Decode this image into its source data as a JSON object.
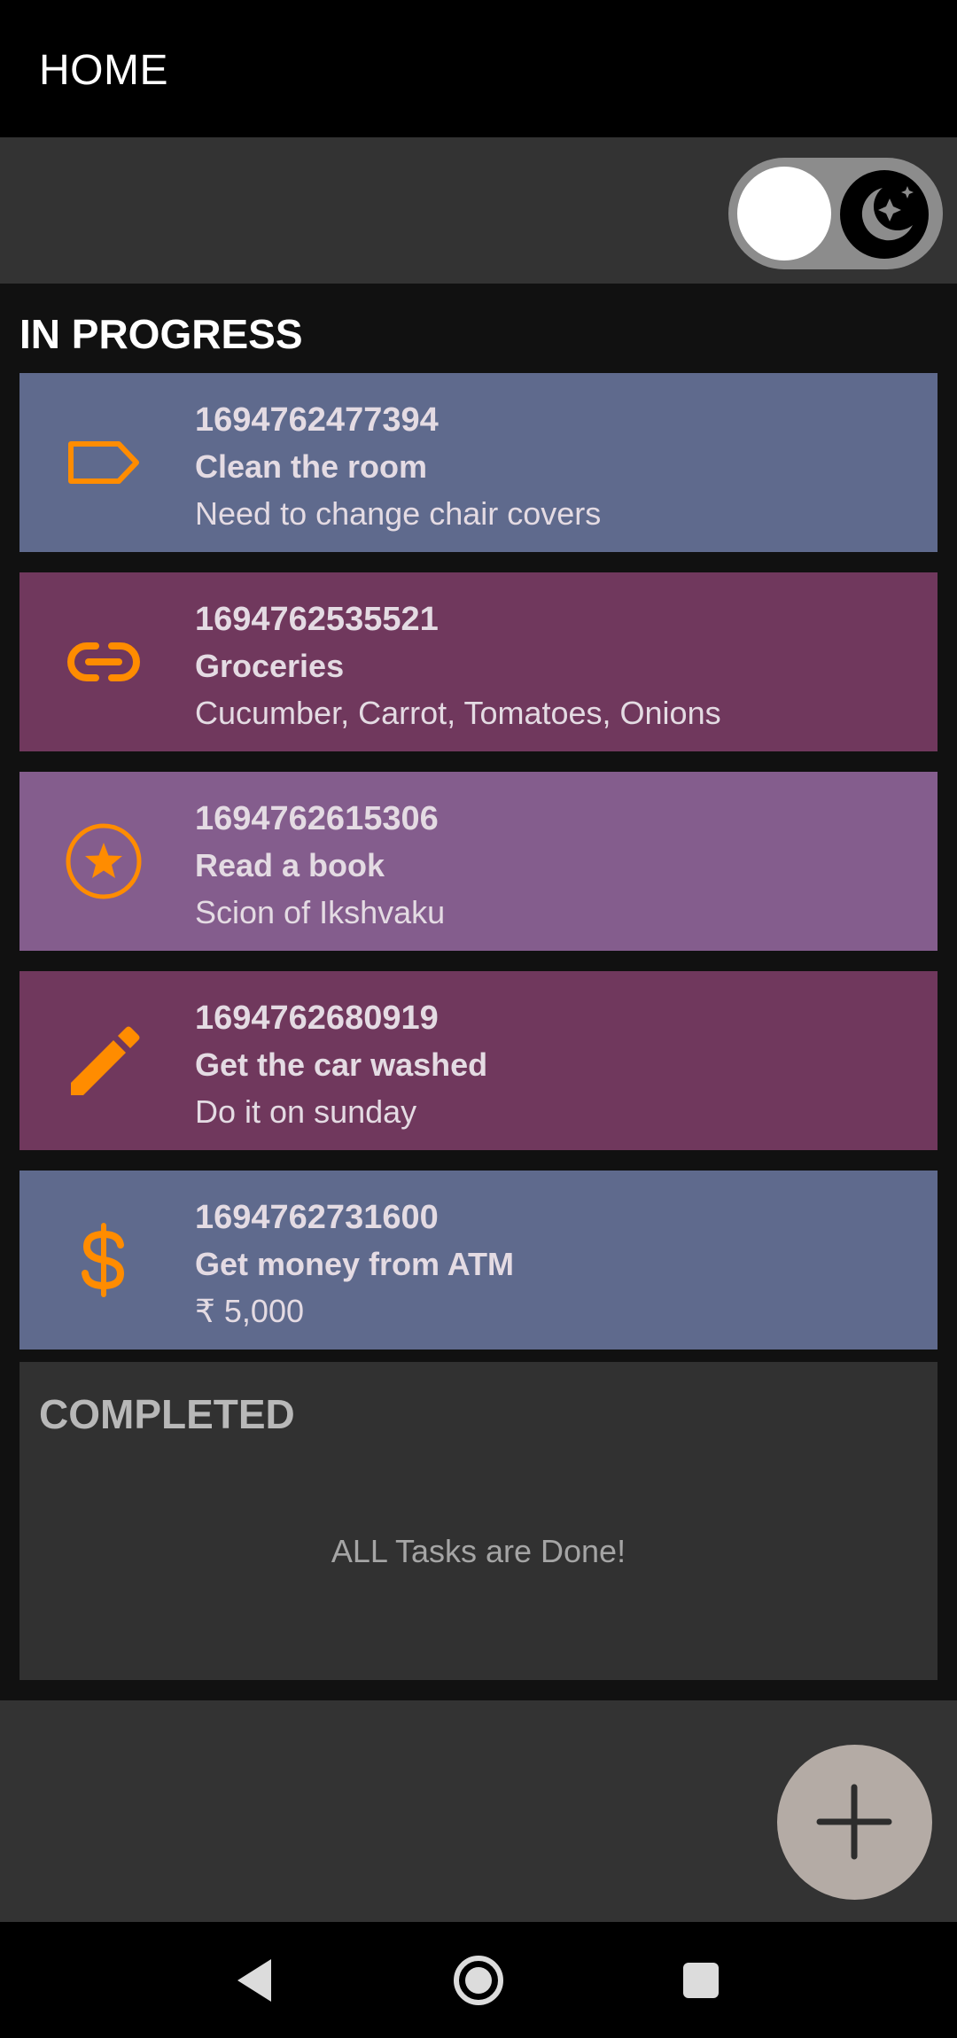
{
  "app_bar": {
    "title": "HOME"
  },
  "theme_toggle": {
    "state": "off",
    "icon": "moon-stars-icon"
  },
  "in_progress": {
    "heading": "IN PROGRESS",
    "tasks": [
      {
        "id": "1694762477394",
        "title": "Clean the room",
        "description": "Need to change chair covers",
        "icon": "label-icon",
        "color": "#5f6a8d"
      },
      {
        "id": "1694762535521",
        "title": "Groceries",
        "description": "Cucumber, Carrot, Tomatoes, Onions",
        "icon": "link-icon",
        "color": "#70385d"
      },
      {
        "id": "1694762615306",
        "title": "Read a book",
        "description": "Scion of Ikshvaku",
        "icon": "star-circle-icon",
        "color": "#845d8d"
      },
      {
        "id": "1694762680919",
        "title": "Get the car washed",
        "description": "Do it on sunday",
        "icon": "pencil-icon",
        "color": "#70385d"
      },
      {
        "id": "1694762731600",
        "title": "Get money from ATM",
        "description": "₹ 5,000",
        "icon": "dollar-icon",
        "color": "#5f6a8d"
      }
    ]
  },
  "completed": {
    "heading": "COMPLETED",
    "empty_message": "ALL Tasks are Done!"
  },
  "fab": {
    "icon": "plus-icon"
  },
  "navigation": {
    "back": "back-icon",
    "home": "home-icon",
    "recents": "recents-icon"
  },
  "colors": {
    "accent_icon": "#ff8c00",
    "fab": "#b4aba5"
  }
}
